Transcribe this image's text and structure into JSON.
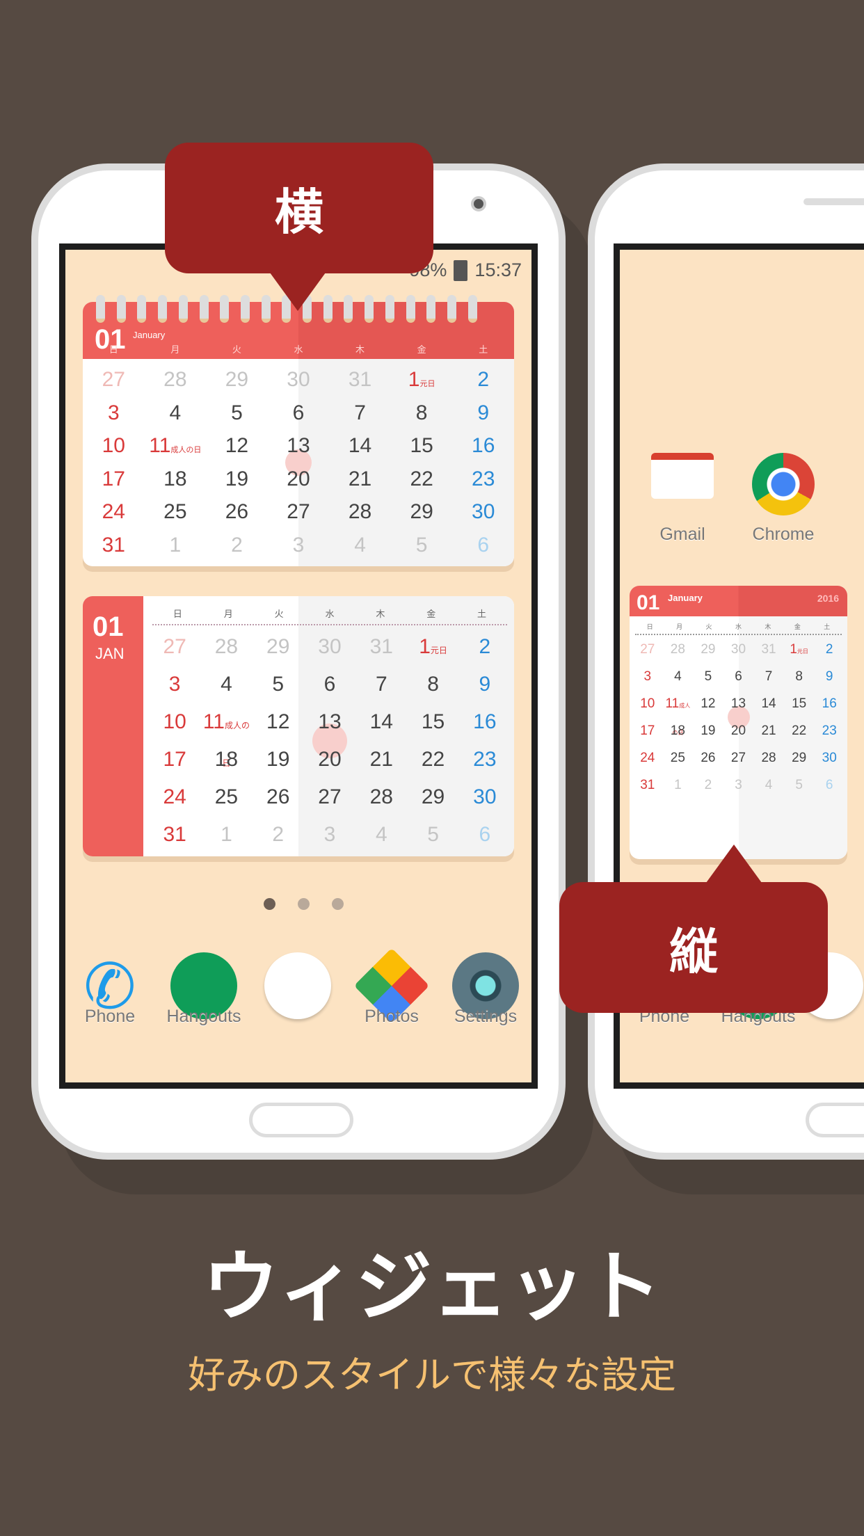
{
  "colors": {
    "background": "#564a42",
    "accent": "#ee5d59",
    "bubble": "#9b2321",
    "sunday": "#d93a3a",
    "saturday": "#2a8ad6",
    "subtitle": "#f6c171"
  },
  "bubble_horizontal": "横",
  "bubble_vertical": "縦",
  "status_bar": {
    "battery": "98%",
    "time": "15:37"
  },
  "calendar": {
    "month_num": "01",
    "month_name": "January",
    "month_abbr": "JAN",
    "year": "2016",
    "weekdays": [
      "日",
      "月",
      "火",
      "水",
      "木",
      "金",
      "土"
    ],
    "today": "6",
    "weeks": [
      [
        {
          "d": "27",
          "t": "prev-sun"
        },
        {
          "d": "28",
          "t": "prev"
        },
        {
          "d": "29",
          "t": "prev"
        },
        {
          "d": "30",
          "t": "prev"
        },
        {
          "d": "31",
          "t": "prev"
        },
        {
          "d": "1",
          "t": "hol",
          "h": "元日"
        },
        {
          "d": "2",
          "t": "sat"
        }
      ],
      [
        {
          "d": "3",
          "t": "sun"
        },
        {
          "d": "4"
        },
        {
          "d": "5"
        },
        {
          "d": "6",
          "t": "today"
        },
        {
          "d": "7"
        },
        {
          "d": "8"
        },
        {
          "d": "9",
          "t": "sat"
        }
      ],
      [
        {
          "d": "10",
          "t": "sun"
        },
        {
          "d": "11",
          "t": "hol",
          "h": "成人の日"
        },
        {
          "d": "12"
        },
        {
          "d": "13"
        },
        {
          "d": "14"
        },
        {
          "d": "15"
        },
        {
          "d": "16",
          "t": "sat"
        }
      ],
      [
        {
          "d": "17",
          "t": "sun"
        },
        {
          "d": "18"
        },
        {
          "d": "19"
        },
        {
          "d": "20"
        },
        {
          "d": "21"
        },
        {
          "d": "22"
        },
        {
          "d": "23",
          "t": "sat"
        }
      ],
      [
        {
          "d": "24",
          "t": "sun"
        },
        {
          "d": "25"
        },
        {
          "d": "26"
        },
        {
          "d": "27"
        },
        {
          "d": "28"
        },
        {
          "d": "29"
        },
        {
          "d": "30",
          "t": "sat"
        }
      ],
      [
        {
          "d": "31",
          "t": "sun"
        },
        {
          "d": "1",
          "t": "next"
        },
        {
          "d": "2",
          "t": "next"
        },
        {
          "d": "3",
          "t": "next"
        },
        {
          "d": "4",
          "t": "next"
        },
        {
          "d": "5",
          "t": "next"
        },
        {
          "d": "6",
          "t": "next-sat"
        }
      ]
    ]
  },
  "home": {
    "apps": [
      {
        "label": "Gmail",
        "icon": "gmail-icon"
      },
      {
        "label": "Chrome",
        "icon": "chrome-icon"
      }
    ]
  },
  "dock": [
    {
      "label": "Phone",
      "icon": "phone-icon"
    },
    {
      "label": "Hangouts",
      "icon": "hangouts-icon"
    },
    {
      "label": "",
      "icon": "app-drawer-icon"
    },
    {
      "label": "Photos",
      "icon": "photos-icon"
    },
    {
      "label": "Settings",
      "icon": "settings-icon"
    }
  ],
  "page_indicator": {
    "count": 3,
    "active": 0
  },
  "title": "ウィジェット",
  "subtitle": "好みのスタイルで様々な設定"
}
